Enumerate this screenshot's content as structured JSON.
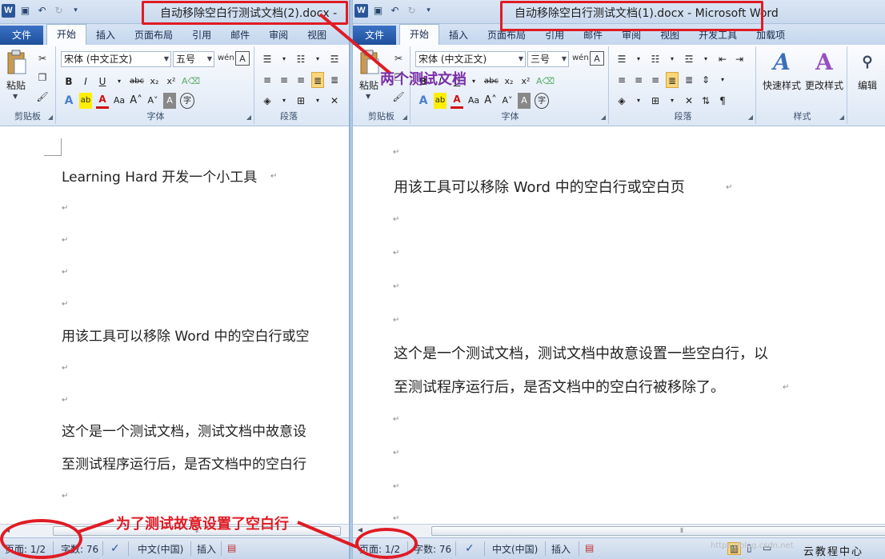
{
  "left": {
    "title": "自动移除空白行测试文档(2).docx -",
    "tabs": [
      "文件",
      "开始",
      "插入",
      "页面布局",
      "引用",
      "邮件",
      "审阅",
      "视图"
    ],
    "ribbon": {
      "paste_label": "粘贴",
      "clipboard_label": "剪贴板",
      "font_label": "字体",
      "paragraph_label": "段落",
      "font_name": "宋体 (中文正文)",
      "font_size": "五号"
    },
    "doc_lines": [
      "Learning Hard 开发一个小工具",
      "用该工具可以移除 Word 中的空白行或空",
      "这个是一个测试文档，测试文档中故意设",
      "至测试程序运行后，是否文档中的空白行"
    ],
    "status": {
      "page": "页面: 1/2",
      "words": "字数: 76",
      "language": "中文(中国)",
      "mode": "插入"
    }
  },
  "right": {
    "title": "自动移除空白行测试文档(1).docx - Microsoft Word",
    "tabs": [
      "文件",
      "开始",
      "插入",
      "页面布局",
      "引用",
      "邮件",
      "审阅",
      "视图",
      "开发工具",
      "加载项"
    ],
    "ribbon": {
      "paste_label": "粘贴",
      "clipboard_label": "剪贴板",
      "font_label": "字体",
      "paragraph_label": "段落",
      "styles_label": "样式",
      "font_name": "宋体 (中文正文)",
      "font_size": "三号",
      "quick_styles": "快速样式",
      "change_styles": "更改样式",
      "editing": "编辑"
    },
    "doc_lines": [
      "用该工具可以移除 Word 中的空白行或空白页",
      "这个是一个测试文档，测试文档中故意设置一些空白行，以",
      "至测试程序运行后，是否文档中的空白行被移除了。"
    ],
    "status": {
      "page": "页面: 1/2",
      "words": "字数: 76",
      "language": "中文(中国)",
      "mode": "插入"
    }
  },
  "annotations": {
    "two_docs": "两个测试文档",
    "blank_lines": "为了测试故意设置了空白行"
  },
  "watermark": "云教程中心",
  "watermark_faint": "https://blog.csdn.net",
  "colors": {
    "annotation_red": "#e01b24",
    "annotation_purple": "#7b2fa8",
    "file_tab_blue": "#2a5da8"
  }
}
